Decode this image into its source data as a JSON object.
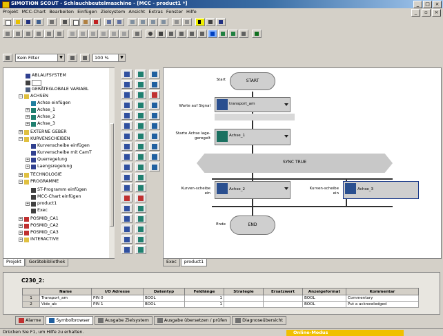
{
  "window": {
    "title": "SIMOTION SCOUT - Schlauchbeutelmaschine - [MCC - product1 *]",
    "controls": [
      "_",
      "□",
      "×"
    ]
  },
  "menu": [
    "Projekt",
    "MCC-Chart",
    "Bearbeiten",
    "Einfügen",
    "Zielsystem",
    "Ansicht",
    "Extras",
    "Fenster",
    "Hilfe"
  ],
  "filters": {
    "filter_value": "Kein Filter",
    "zoom_value": "100 %"
  },
  "tree": {
    "items": [
      {
        "label": "ABLAUFSYSTEM"
      },
      {
        "label": ""
      },
      {
        "label": "GERÄTEGLOBALE VARIABL"
      },
      {
        "label": "ACHSEN"
      },
      {
        "label": "Achse einfügen"
      },
      {
        "label": "Achse_1"
      },
      {
        "label": "Achse_2"
      },
      {
        "label": "Achse_3"
      },
      {
        "label": "EXTERNE GEBER"
      },
      {
        "label": "KURVENSCHEIBEN"
      },
      {
        "label": "Kurvenscheibe einfügen"
      },
      {
        "label": "Kurvenscheibe mit CamT"
      },
      {
        "label": "Querregelung"
      },
      {
        "label": "Laengsregelung"
      },
      {
        "label": "TECHNOLOGIE"
      },
      {
        "label": "PROGRAMME"
      },
      {
        "label": "ST-Programm einfügen"
      },
      {
        "label": "MCC-Chart einfügen"
      },
      {
        "label": "product1"
      },
      {
        "label": "Exec"
      },
      {
        "label": "POSMID_CA1"
      },
      {
        "label": "POSMID_CA2"
      },
      {
        "label": "POSMID_CA3"
      },
      {
        "label": "INTERACTIVE"
      }
    ],
    "tabs": [
      "Projekt",
      "Gerätebibliothek"
    ]
  },
  "chart": {
    "start_side": "Start",
    "start": "START",
    "wait_side": "Warte auf Signal",
    "wait_node": "transport_am",
    "pos_side": "Starte Achse lage-geregelt",
    "pos_node": "Achse_1",
    "sync": "SYNC TRUE",
    "cam_left_side": "Kurven-scheibe ein",
    "cam_left_node": "Achse_2",
    "cam_right_side": "Kurven-scheibe ein",
    "cam_right_node": "Achse_3",
    "end_side": "Ende",
    "end": "END",
    "tabs": [
      "Exec",
      "product1"
    ]
  },
  "details": {
    "label": "C230_2:",
    "columns": [
      "",
      "Name",
      "I/O Adresse",
      "Datentyp",
      "Feldlänge",
      "Strategie",
      "Ersatzwert",
      "Anzeigeformat",
      "Kommentar"
    ],
    "rows": [
      [
        "1",
        "Transport_am",
        "PIN 0",
        "BOOL",
        "1",
        "",
        "",
        "BOOL",
        "Commentary"
      ],
      [
        "2",
        "Vide_ab",
        "PIN 1",
        "BOOL",
        "1",
        "",
        "",
        "BOOL",
        "Put a acknowledged"
      ]
    ],
    "tabs": [
      "Alarme",
      "Symbolbrowser",
      "Ausgabe Zielsystem",
      "Ausgabe übersetzen / prüfen",
      "Diagnoseübersicht"
    ]
  },
  "status": {
    "message": "Drücken Sie F1, um Hilfe zu erhalten.",
    "mode": "Online-Modus"
  }
}
